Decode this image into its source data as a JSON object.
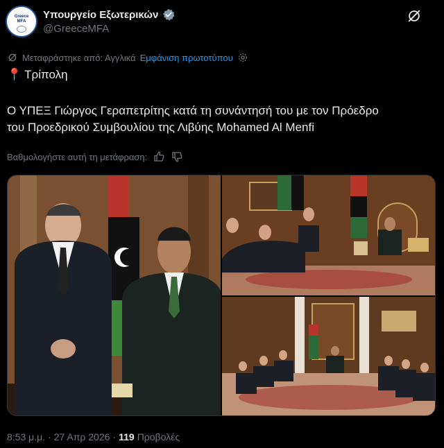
{
  "account": {
    "display_name": "Υπουργείο Εξωτερικών",
    "handle": "@GreeceMFA",
    "avatar_text": [
      "Greece",
      "MFA"
    ],
    "verified_badge": "gray-checkmark-badge-icon"
  },
  "translation": {
    "translated_from": "Μεταφράστηκε από: Αγγλικά",
    "show_original": "Εμφάνιση πρωτοτύπου",
    "rate_prompt": "Βαθμολογήστε αυτή τη μετάφραση:"
  },
  "tweet": {
    "location_pin": "📍",
    "location": "Τρίπολη",
    "text_line1": "Ο ΥΠΕΞ Γιώργος Γεραπετρίτης κατά τη συνάντησή του με τον Πρόεδρο",
    "text_line2": "του Προεδρικού Συμβουλίου της Λιβύης Mohamed Al Menfi"
  },
  "media": {
    "photos": [
      "photo-portrait-two-officials",
      "photo-meeting-room-wide",
      "photo-meeting-room-wider"
    ]
  },
  "footer": {
    "time": "8:53 μ.μ.",
    "separator": "·",
    "date": "27 Απρ 2026",
    "views_count": "119",
    "views_label": "Προβολές"
  },
  "colors": {
    "background": "#000000",
    "text": "#e7e9ea",
    "muted": "#71767b",
    "link": "#1d9bf0"
  }
}
